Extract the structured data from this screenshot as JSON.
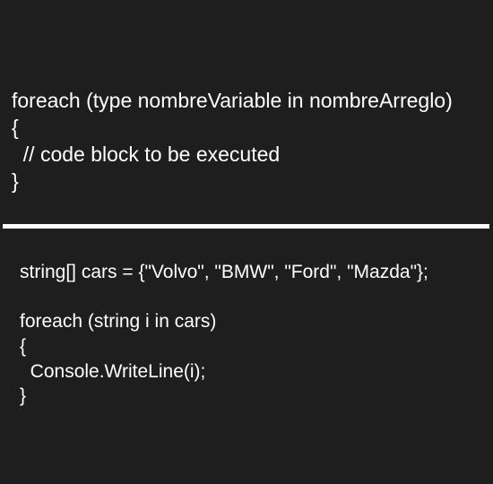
{
  "syntax_block": {
    "lines": [
      "foreach (type nombreVariable in nombreArreglo)",
      "{",
      "  // code block to be executed",
      "}"
    ]
  },
  "example_block": {
    "lines": [
      "string[] cars = {\"Volvo\", \"BMW\", \"Ford\", \"Mazda\"};",
      "",
      "foreach (string i in cars)",
      "{",
      "  Console.WriteLine(i);",
      "}"
    ]
  }
}
